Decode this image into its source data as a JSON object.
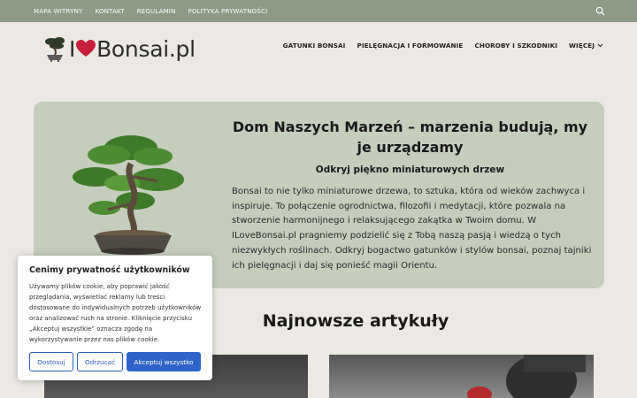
{
  "topbar": {
    "links": [
      "MAPA WITRYNY",
      "KONTAKT",
      "REGULAMIN",
      "POLITYKA PRYWATNOŚCI"
    ],
    "search_icon": "search-icon",
    "bg_color": "#8d9a86"
  },
  "header": {
    "logo_prefix": "I",
    "logo_name": "Bonsai.pl",
    "nav": [
      "GATUNKI BONSAI",
      "PIELĘGNACJA I FORMOWANIE",
      "CHOROBY I SZKODNIKI",
      "WIĘCEJ"
    ]
  },
  "hero": {
    "title": "Dom Naszych Marzeń – marzenia budują, my je urządzamy",
    "subtitle": "Odkryj piękno miniaturowych drzew",
    "text": "Bonsai to nie tylko miniaturowe drzewa, to sztuka, która od wieków zachwyca i inspiruje. To połączenie ogrodnictwa, filozofii i medytacji, które pozwala na stworzenie harmonijnego i relaksującego zakątka w Twoim domu. W ILoveBonsai.pl pragniemy podzielić się z Tobą naszą pasją i wiedzą o tych niezwykłych roślinach. Odkryj bogactwo gatunków i stylów bonsai, poznaj tajniki ich pielęgnacji i daj się ponieść magii Orientu.",
    "bg_color": "#c5cdbd"
  },
  "articles": {
    "title": "Najnowsze artykuły"
  },
  "cookie": {
    "title": "Cenimy prywatność użytkowników",
    "text": "Używamy plików cookie, aby poprawić jakość przeglądania, wyświetlać reklamy lub treści dostosowane do indywidualnych potrzeb użytkowników oraz analizować ruch na stronie. Kliknięcie przycisku „Akceptuj wszystkie” oznacza zgodę na wykorzystywanie przez nas plików cookie.",
    "btn_customize": "Dostosuj",
    "btn_refuse": "Odrzucać",
    "btn_accept": "Akceptuj wszystko",
    "accent_color": "#2f63c9"
  }
}
